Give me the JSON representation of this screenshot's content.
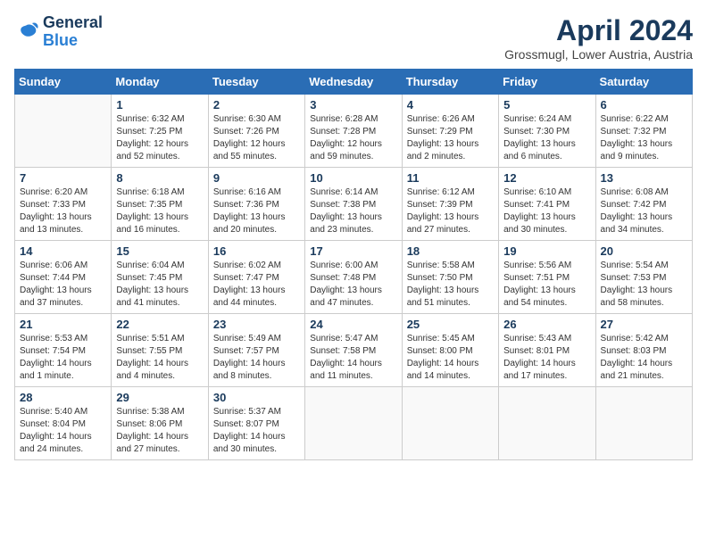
{
  "logo": {
    "line1": "General",
    "line2": "Blue"
  },
  "title": "April 2024",
  "location": "Grossmugl, Lower Austria, Austria",
  "days_header": [
    "Sunday",
    "Monday",
    "Tuesday",
    "Wednesday",
    "Thursday",
    "Friday",
    "Saturday"
  ],
  "weeks": [
    [
      {
        "num": "",
        "info": ""
      },
      {
        "num": "1",
        "info": "Sunrise: 6:32 AM\nSunset: 7:25 PM\nDaylight: 12 hours\nand 52 minutes."
      },
      {
        "num": "2",
        "info": "Sunrise: 6:30 AM\nSunset: 7:26 PM\nDaylight: 12 hours\nand 55 minutes."
      },
      {
        "num": "3",
        "info": "Sunrise: 6:28 AM\nSunset: 7:28 PM\nDaylight: 12 hours\nand 59 minutes."
      },
      {
        "num": "4",
        "info": "Sunrise: 6:26 AM\nSunset: 7:29 PM\nDaylight: 13 hours\nand 2 minutes."
      },
      {
        "num": "5",
        "info": "Sunrise: 6:24 AM\nSunset: 7:30 PM\nDaylight: 13 hours\nand 6 minutes."
      },
      {
        "num": "6",
        "info": "Sunrise: 6:22 AM\nSunset: 7:32 PM\nDaylight: 13 hours\nand 9 minutes."
      }
    ],
    [
      {
        "num": "7",
        "info": "Sunrise: 6:20 AM\nSunset: 7:33 PM\nDaylight: 13 hours\nand 13 minutes."
      },
      {
        "num": "8",
        "info": "Sunrise: 6:18 AM\nSunset: 7:35 PM\nDaylight: 13 hours\nand 16 minutes."
      },
      {
        "num": "9",
        "info": "Sunrise: 6:16 AM\nSunset: 7:36 PM\nDaylight: 13 hours\nand 20 minutes."
      },
      {
        "num": "10",
        "info": "Sunrise: 6:14 AM\nSunset: 7:38 PM\nDaylight: 13 hours\nand 23 minutes."
      },
      {
        "num": "11",
        "info": "Sunrise: 6:12 AM\nSunset: 7:39 PM\nDaylight: 13 hours\nand 27 minutes."
      },
      {
        "num": "12",
        "info": "Sunrise: 6:10 AM\nSunset: 7:41 PM\nDaylight: 13 hours\nand 30 minutes."
      },
      {
        "num": "13",
        "info": "Sunrise: 6:08 AM\nSunset: 7:42 PM\nDaylight: 13 hours\nand 34 minutes."
      }
    ],
    [
      {
        "num": "14",
        "info": "Sunrise: 6:06 AM\nSunset: 7:44 PM\nDaylight: 13 hours\nand 37 minutes."
      },
      {
        "num": "15",
        "info": "Sunrise: 6:04 AM\nSunset: 7:45 PM\nDaylight: 13 hours\nand 41 minutes."
      },
      {
        "num": "16",
        "info": "Sunrise: 6:02 AM\nSunset: 7:47 PM\nDaylight: 13 hours\nand 44 minutes."
      },
      {
        "num": "17",
        "info": "Sunrise: 6:00 AM\nSunset: 7:48 PM\nDaylight: 13 hours\nand 47 minutes."
      },
      {
        "num": "18",
        "info": "Sunrise: 5:58 AM\nSunset: 7:50 PM\nDaylight: 13 hours\nand 51 minutes."
      },
      {
        "num": "19",
        "info": "Sunrise: 5:56 AM\nSunset: 7:51 PM\nDaylight: 13 hours\nand 54 minutes."
      },
      {
        "num": "20",
        "info": "Sunrise: 5:54 AM\nSunset: 7:53 PM\nDaylight: 13 hours\nand 58 minutes."
      }
    ],
    [
      {
        "num": "21",
        "info": "Sunrise: 5:53 AM\nSunset: 7:54 PM\nDaylight: 14 hours\nand 1 minute."
      },
      {
        "num": "22",
        "info": "Sunrise: 5:51 AM\nSunset: 7:55 PM\nDaylight: 14 hours\nand 4 minutes."
      },
      {
        "num": "23",
        "info": "Sunrise: 5:49 AM\nSunset: 7:57 PM\nDaylight: 14 hours\nand 8 minutes."
      },
      {
        "num": "24",
        "info": "Sunrise: 5:47 AM\nSunset: 7:58 PM\nDaylight: 14 hours\nand 11 minutes."
      },
      {
        "num": "25",
        "info": "Sunrise: 5:45 AM\nSunset: 8:00 PM\nDaylight: 14 hours\nand 14 minutes."
      },
      {
        "num": "26",
        "info": "Sunrise: 5:43 AM\nSunset: 8:01 PM\nDaylight: 14 hours\nand 17 minutes."
      },
      {
        "num": "27",
        "info": "Sunrise: 5:42 AM\nSunset: 8:03 PM\nDaylight: 14 hours\nand 21 minutes."
      }
    ],
    [
      {
        "num": "28",
        "info": "Sunrise: 5:40 AM\nSunset: 8:04 PM\nDaylight: 14 hours\nand 24 minutes."
      },
      {
        "num": "29",
        "info": "Sunrise: 5:38 AM\nSunset: 8:06 PM\nDaylight: 14 hours\nand 27 minutes."
      },
      {
        "num": "30",
        "info": "Sunrise: 5:37 AM\nSunset: 8:07 PM\nDaylight: 14 hours\nand 30 minutes."
      },
      {
        "num": "",
        "info": ""
      },
      {
        "num": "",
        "info": ""
      },
      {
        "num": "",
        "info": ""
      },
      {
        "num": "",
        "info": ""
      }
    ]
  ]
}
